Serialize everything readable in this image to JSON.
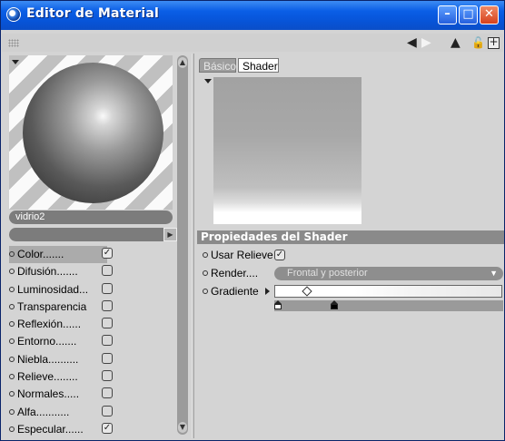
{
  "window": {
    "title": "Editor de Material"
  },
  "titlebar_buttons": [
    {
      "name": "minimize",
      "glyph": "–"
    },
    {
      "name": "maximize",
      "glyph": "□"
    },
    {
      "name": "close",
      "glyph": "✕"
    }
  ],
  "toolbar": {
    "icons": [
      "back-arrow-icon",
      "forward-arrow-icon",
      "cursor-arrow-icon",
      "lock-icon",
      "new-window-icon"
    ]
  },
  "material": {
    "name": "vidrio2"
  },
  "channels": [
    {
      "label": "Color",
      "dots": ".......",
      "checked": true,
      "selected": true
    },
    {
      "label": "Difusión",
      "dots": ".......",
      "checked": false
    },
    {
      "label": "Luminosidad",
      "dots": "...",
      "checked": false
    },
    {
      "label": "Transparencia",
      "dots": "",
      "checked": false
    },
    {
      "label": "Reflexión",
      "dots": "......",
      "checked": false
    },
    {
      "label": "Entorno",
      "dots": ".......",
      "checked": false
    },
    {
      "label": "Niebla",
      "dots": "..........",
      "checked": false
    },
    {
      "label": "Relieve",
      "dots": "........",
      "checked": false
    },
    {
      "label": "Normales",
      "dots": ".....",
      "checked": false
    },
    {
      "label": "Alfa",
      "dots": "...........",
      "checked": false
    },
    {
      "label": "Especular",
      "dots": "......",
      "checked": true
    }
  ],
  "tabs": {
    "basic": "Básico",
    "shader": "Shader"
  },
  "shader_props": {
    "header": "Propiedades del Shader",
    "use_relief_label": "Usar Relieve",
    "use_relief_checked": true,
    "render_label": "Render",
    "render_dots": "....",
    "render_value": "Frontal y posterior",
    "gradient_label": "Gradiente"
  },
  "colors": {
    "title_blue": "#0754d8",
    "header_gray": "#8a8a8a"
  }
}
